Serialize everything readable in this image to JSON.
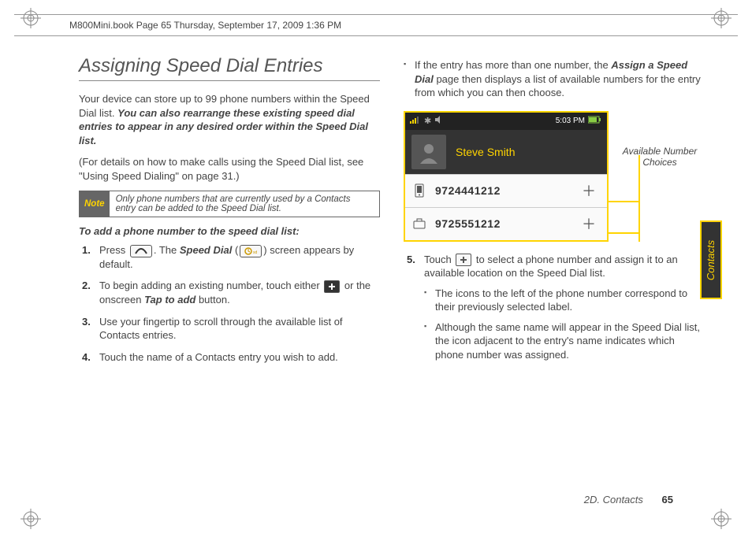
{
  "header": {
    "crop_info": "M800Mini.book  Page 65  Thursday, September 17, 2009  1:36 PM"
  },
  "left": {
    "heading": "Assigning Speed Dial Entries",
    "intro_a": "Your device can store up to 99 phone numbers within the Speed Dial list. ",
    "intro_b": "You can also rearrange these existing speed dial entries to appear in any desired order within the Speed Dial list.",
    "detail_ref": "(For details on how to make calls using the Speed Dial list, see \"Using Speed Dialing\" on page 31.)",
    "note_label": "Note",
    "note_text": "Only phone numbers that are currently used by a Contacts entry can be added to the Speed Dial list.",
    "subhead": "To add a phone number to the speed dial list:",
    "step1_a": "Press ",
    "step1_b": ". The ",
    "step1_c": "Speed Dial",
    "step1_d": " (",
    "step1_e": ") screen appears by default.",
    "step2_a": "To begin adding an existing number, touch either ",
    "step2_b": " or the onscreen ",
    "step2_c": "Tap to add",
    "step2_d": " button.",
    "step3": "Use your fingertip to scroll through the available list of Contacts entries.",
    "step4": "Touch the name of a Contacts entry you wish to add."
  },
  "right": {
    "bullet1_a": "If the entry has more than one number, the ",
    "bullet1_b": "Assign a Speed Dial",
    "bullet1_c": " page then displays a list of available numbers for the entry from which you can then choose.",
    "callout": "Available Number Choices",
    "shot": {
      "time": "5:03 PM",
      "name": "Steve Smith",
      "num1": "9724441212",
      "num2": "9725551212"
    },
    "step5_a": "Touch ",
    "step5_b": " to select a phone number and assign it to an available location on the Speed Dial list.",
    "sub_a": "The icons to the left of the phone number correspond to their previously selected label.",
    "sub_b": "Although the same name will appear in the Speed Dial list, the icon adjacent to the entry's name indicates which phone number was assigned."
  },
  "footer": {
    "section": "2D. Contacts",
    "page": "65"
  },
  "sidetab": "Contacts"
}
